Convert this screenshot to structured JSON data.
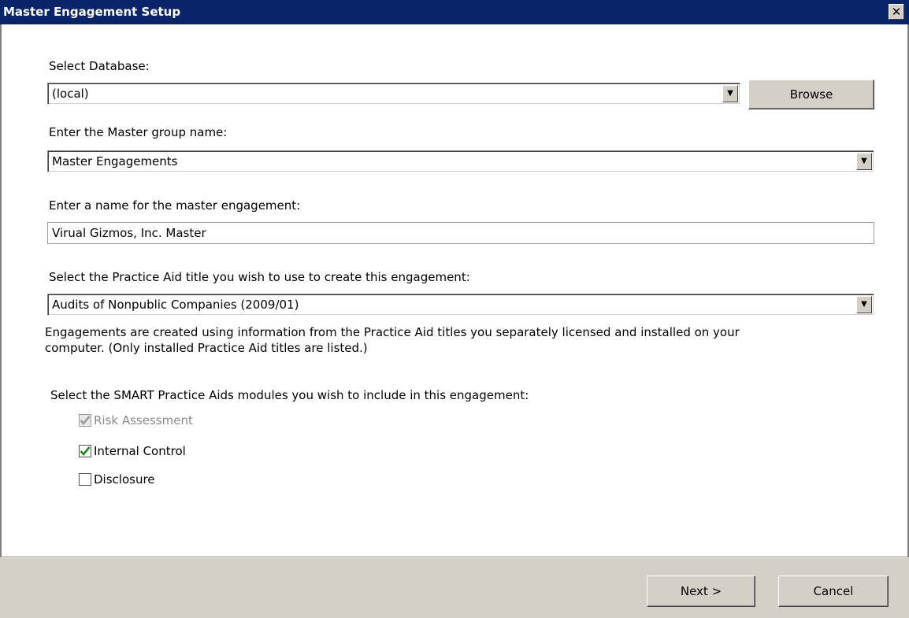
{
  "window": {
    "title": "Master Engagement Setup",
    "close_glyph": "✕"
  },
  "database": {
    "label": "Select Database:",
    "value": "(local)",
    "browse_label": "Browse"
  },
  "group": {
    "label": "Enter the Master group name:",
    "value": "Master Engagements"
  },
  "engagement": {
    "label": "Enter a name for the master engagement:",
    "value": "Virual Gizmos, Inc. Master"
  },
  "practice_aid": {
    "label": "Select the Practice Aid title you wish to use to create this engagement:",
    "value": "Audits of Nonpublic Companies (2009/01)",
    "note_line1": "Engagements are created using information from the Practice Aid titles you separately licensed and installed on your",
    "note_line2": "computer. (Only installed Practice Aid titles are listed.)"
  },
  "modules": {
    "label": "Select the SMART Practice Aids modules you wish to include in this engagement:",
    "items": [
      {
        "label": "Risk Assessment",
        "checked": true,
        "enabled": false
      },
      {
        "label": "Internal Control",
        "checked": true,
        "enabled": true
      },
      {
        "label": "Disclosure",
        "checked": false,
        "enabled": true
      }
    ]
  },
  "footer": {
    "next_label": "Next >",
    "cancel_label": "Cancel"
  },
  "colors": {
    "titlebar": "#0a246a",
    "face": "#d4d0c8",
    "check_enabled": "#1e8a1e",
    "check_disabled": "#9a9a9a"
  }
}
